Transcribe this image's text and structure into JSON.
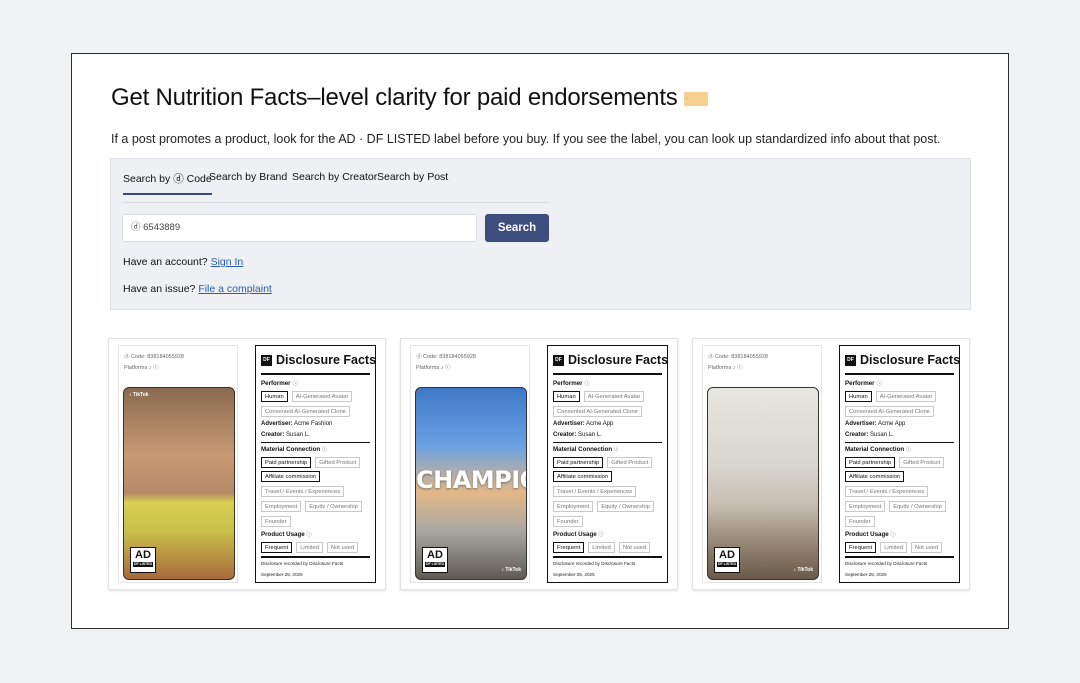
{
  "page": {
    "title": "Get Nutrition Facts–level clarity for paid endorsements",
    "title_tag_icon": "price-tag-icon",
    "subtitle": "If a post promotes a product, look for the AD · DF LISTED label before you buy. If you see the label, you can look up standardized info about that post."
  },
  "search": {
    "tabs": [
      "Search by ⓓ Code",
      "Search by Brand",
      "Search by Creator",
      "Search by Post"
    ],
    "active_tab": 0,
    "input_value": "ⓓ 6543889",
    "button_label": "Search",
    "account_text": "Have an account?",
    "sign_in_label": "Sign In",
    "issue_text": "Have an issue?",
    "complaint_label": "File a complaint"
  },
  "cards": [
    {
      "code": "ⓓ Code: 838184055928",
      "platforms": "Platforms ♪ ⓘ",
      "video_overlay": "",
      "tiktok_top": "♪ TikTok",
      "ad_label": "AD",
      "ad_sub": "DF LISTED",
      "watermark": "",
      "facts": {
        "title": "Disclosure Facts",
        "logo": "DF",
        "performer_label": "Performer",
        "performer_chips": [
          "Human",
          "AI-Generated Avatar",
          "Consented AI-Generated Clone"
        ],
        "performer_selected": "Human",
        "advertiser_key": "Advertiser:",
        "advertiser": "Acme Fashion",
        "creator_key": "Creator:",
        "creator": "Susan L.",
        "material_label": "Material Connection",
        "material_chips": [
          "Paid partnership",
          "Gifted Product",
          "Affiliate commission",
          "Travel / Events / Experiences",
          "Employment",
          "Equity / Ownership",
          "Founder"
        ],
        "material_selected": [
          "Paid partnership",
          "Affiliate commission"
        ],
        "usage_label": "Product Usage",
        "usage_chips": [
          "Frequent",
          "Limited",
          "Not used"
        ],
        "usage_selected": "Frequent",
        "recorded": "Disclosure recorded by Disclosure Facts",
        "date": "September 25, 2025"
      }
    },
    {
      "code": "ⓓ Code: 838184055928",
      "platforms": "Platforms ♪ ⓘ",
      "video_overlay": "CHAMPION",
      "tiktok_top": "",
      "ad_label": "AD",
      "ad_sub": "DF LISTED",
      "watermark": "♪ TikTok",
      "facts": {
        "title": "Disclosure Facts",
        "logo": "DF",
        "performer_label": "Performer",
        "performer_chips": [
          "Human",
          "AI-Generated Avatar",
          "Consented AI-Generated Clone"
        ],
        "performer_selected": "Human",
        "advertiser_key": "Advertiser:",
        "advertiser": "Acme App",
        "creator_key": "Creator:",
        "creator": "Susan L.",
        "material_label": "Material Connection",
        "material_chips": [
          "Paid partnership",
          "Gifted Product",
          "Affiliate commission",
          "Travel / Events / Experiences",
          "Employment",
          "Equity / Ownership",
          "Founder"
        ],
        "material_selected": [
          "Paid partnership",
          "Affiliate commission"
        ],
        "usage_label": "Product Usage",
        "usage_chips": [
          "Frequent",
          "Limited",
          "Not used"
        ],
        "usage_selected": "Frequent",
        "recorded": "Disclosure recorded by Disclosure Facts",
        "date": "September 25, 2025"
      }
    },
    {
      "code": "ⓓ Code: 838184055928",
      "platforms": "Platforms ♪ ⓘ",
      "video_overlay": "",
      "tiktok_top": "",
      "ad_label": "AD",
      "ad_sub": "DF LISTED",
      "watermark": "♪ TikTok",
      "facts": {
        "title": "Disclosure Facts",
        "logo": "DF",
        "performer_label": "Performer",
        "performer_chips": [
          "Human",
          "AI-Generated Avatar",
          "Consented AI-Generated Clone"
        ],
        "performer_selected": "Human",
        "advertiser_key": "Advertiser:",
        "advertiser": "Acme App",
        "creator_key": "Creator:",
        "creator": "Susan L.",
        "material_label": "Material Connection",
        "material_chips": [
          "Paid partnership",
          "Gifted Product",
          "Affiliate commission",
          "Travel / Events / Experiences",
          "Employment",
          "Equity / Ownership",
          "Founder"
        ],
        "material_selected": [
          "Paid partnership",
          "Affiliate commission"
        ],
        "usage_label": "Product Usage",
        "usage_chips": [
          "Frequent",
          "Limited",
          "Not used"
        ],
        "usage_selected": "Frequent",
        "recorded": "Disclosure recorded by Disclosure Facts",
        "date": "September 25, 2025"
      }
    }
  ],
  "colors": {
    "accent": "#3d4d7e",
    "link": "#2b5dab",
    "panel": "#eef0f3",
    "tag": "#f6d08e"
  }
}
